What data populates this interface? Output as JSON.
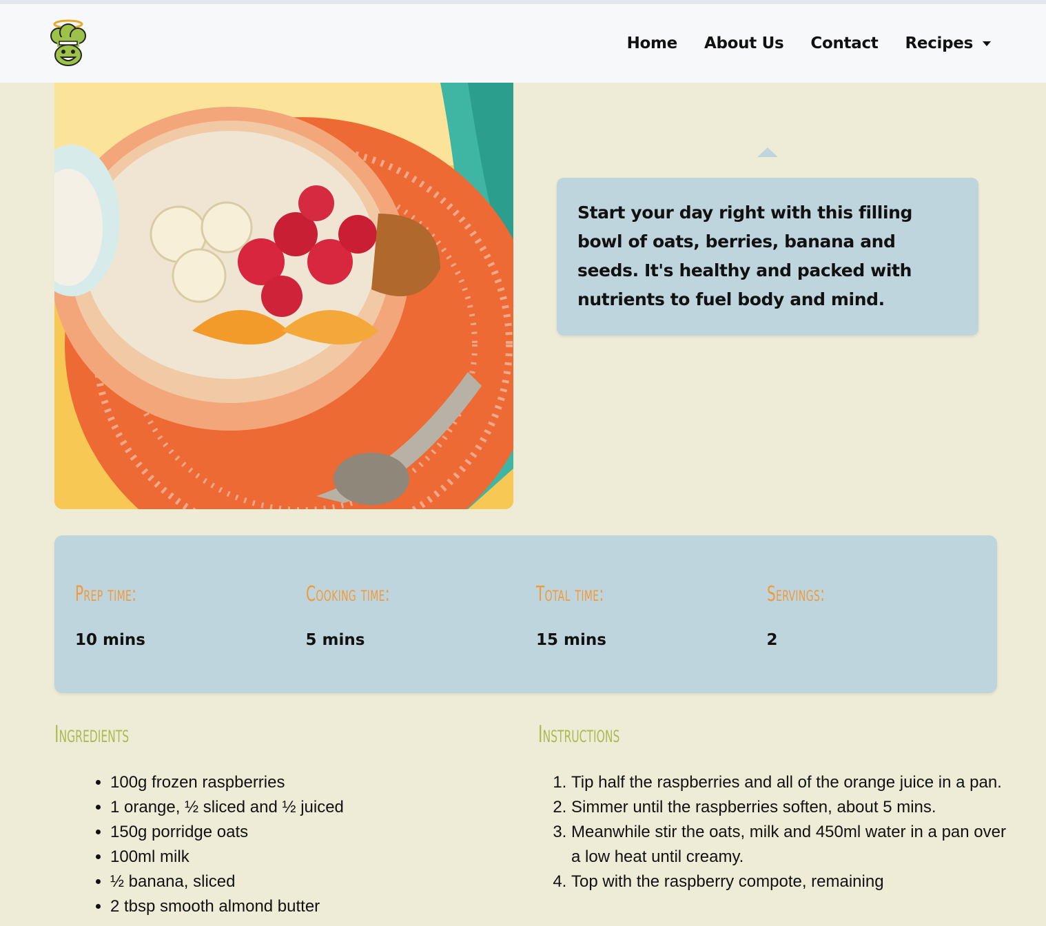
{
  "nav": {
    "logo_alt": "chef mascot logo",
    "links": [
      "Home",
      "About Us",
      "Contact",
      "Recipes"
    ]
  },
  "hero": {
    "image_alt": "bowl of porridge with raspberries, banana, orange and seeds",
    "description": "Start your day right with this filling bowl of oats, berries, banana and seeds. It's healthy and packed with nutrients to fuel body and mind."
  },
  "info": [
    {
      "label": "Prep time:",
      "value": "10 mins"
    },
    {
      "label": "Cooking time:",
      "value": "5 mins"
    },
    {
      "label": "Total time:",
      "value": "15 mins"
    },
    {
      "label": "Servings:",
      "value": "2"
    }
  ],
  "ingredients": {
    "heading": "Ingredients",
    "items": [
      "100g frozen raspberries",
      "1 orange, ½ sliced and ½ juiced",
      "150g porridge oats",
      "100ml milk",
      "½ banana, sliced",
      "2 tbsp smooth almond butter"
    ]
  },
  "instructions": {
    "heading": "Instructions",
    "steps": [
      "Tip half the raspberries and all of the orange juice in a pan.",
      "Simmer until the raspberries soften, about 5 mins.",
      "Meanwhile stir the oats, milk and 450ml water in a pan over a low heat until creamy.",
      "Top with the raspberry compote, remaining"
    ]
  },
  "colors": {
    "background": "#eeecd6",
    "navbar": "#f7f8fa",
    "panel": "#bfd5de",
    "info_label": "#f09a3a",
    "section_heading": "#a9bb52"
  }
}
